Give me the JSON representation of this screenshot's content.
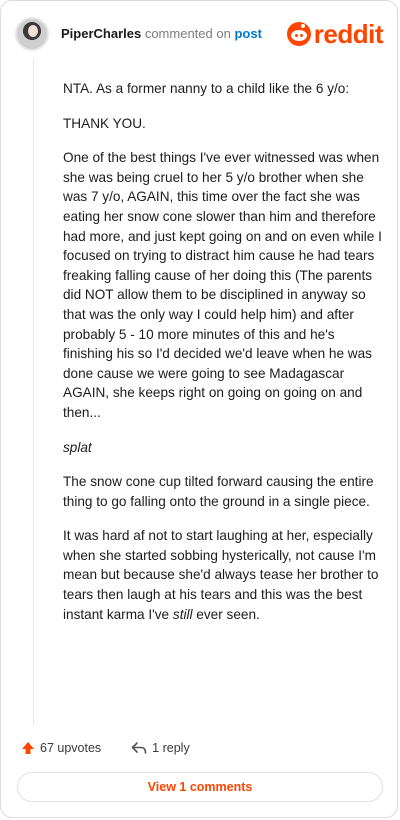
{
  "header": {
    "username": "PiperCharles",
    "commented_text": "commented on",
    "post_link": "post",
    "brand": "reddit"
  },
  "comment": {
    "paragraphs": [
      "NTA. As a former nanny to a child like the 6 y/o:",
      "THANK YOU.",
      "One of the best things I've ever witnessed was when she was being cruel to her 5 y/o brother when she was 7 y/o, AGAIN, this time over the fact she was eating her snow cone slower than him and therefore had more, and just kept going on and on even while I focused on trying to distract him cause he had tears freaking falling cause of her doing this (The parents did NOT allow them to be disciplined in anyway so that was the only way I could help him) and after probably 5 - 10 more minutes of this and he's finishing his so I'd decided we'd leave when he was done cause we were going to see Madagascar AGAIN, she keeps right on going on going on and then...",
      "splat",
      "The snow cone cup tilted forward causing the entire thing to go falling onto the ground in a single piece.",
      "It was hard af not to start laughing at her, especially when she started sobbing hysterically, not cause I'm mean but because she'd always tease her brother to tears then laugh at his tears and this was the best instant karma I've ",
      "still",
      " ever seen."
    ]
  },
  "actions": {
    "upvotes": "67 upvotes",
    "reply": "1 reply"
  },
  "footer": {
    "view_comments": "View 1 comments"
  },
  "colors": {
    "brand": "#ff4500",
    "link": "#0079d3"
  },
  "icons": {
    "upvote": "upvote-arrow-icon",
    "reply": "reply-arrow-icon"
  }
}
